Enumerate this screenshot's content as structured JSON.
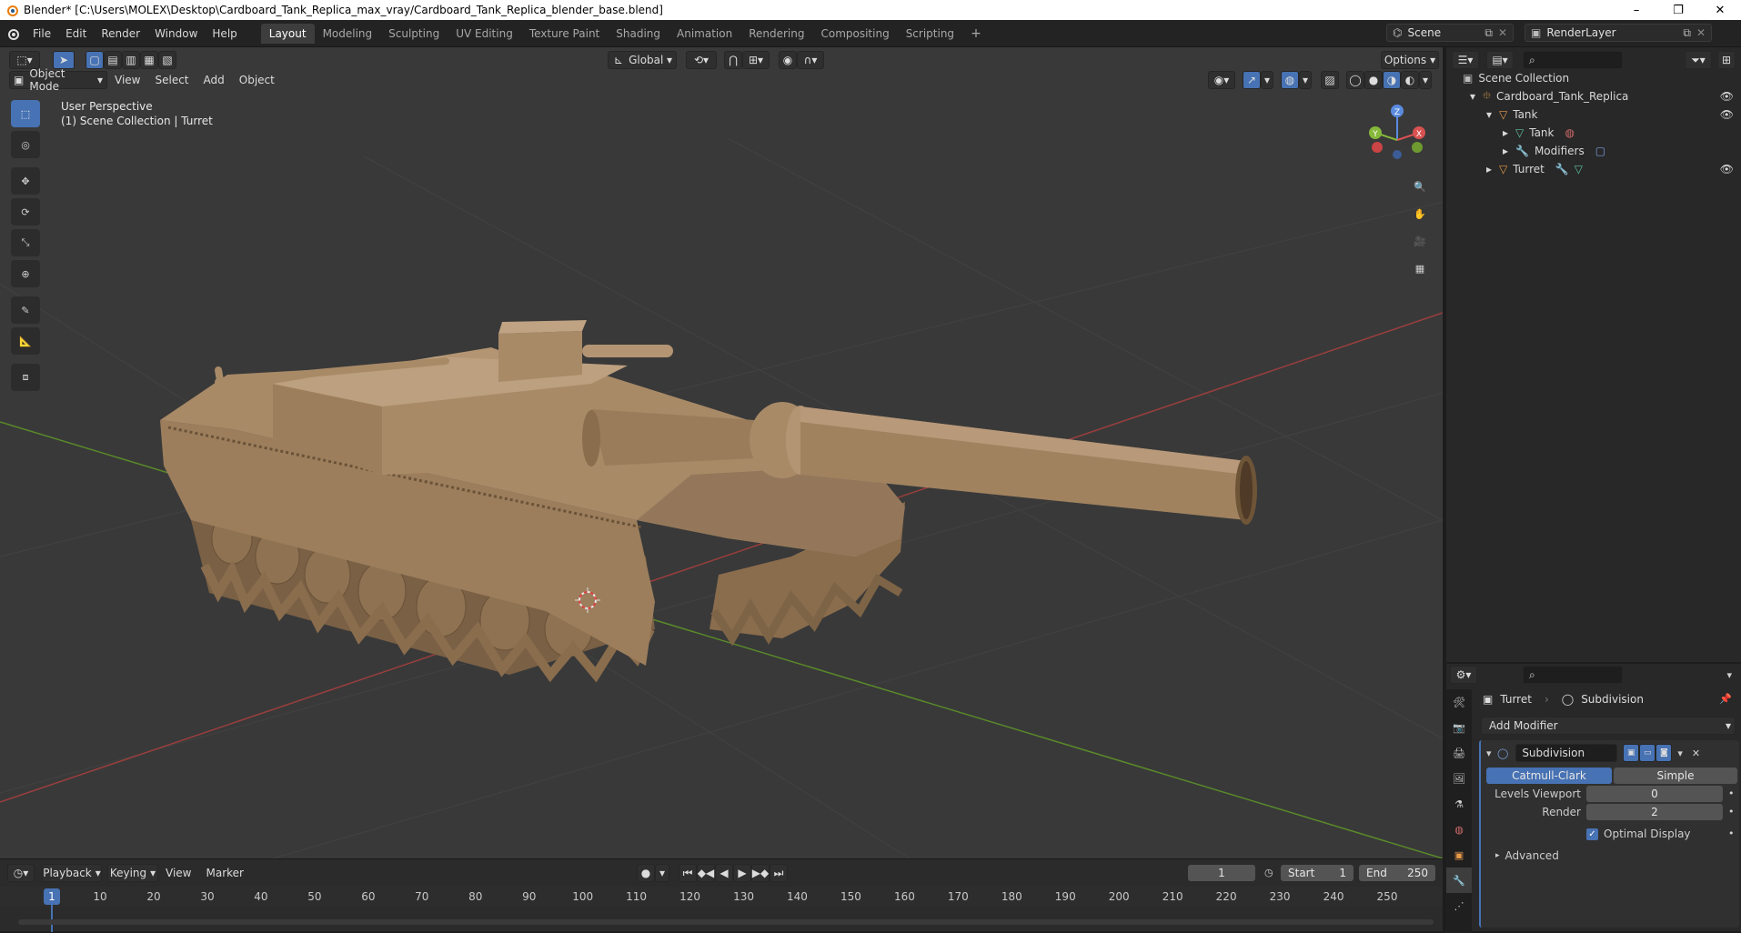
{
  "window": {
    "title": "Blender* [C:\\Users\\MOLEX\\Desktop\\Cardboard_Tank_Replica_max_vray/Cardboard_Tank_Replica_blender_base.blend]",
    "minimize": "–",
    "maximize": "❐",
    "close": "✕"
  },
  "menu": [
    "File",
    "Edit",
    "Render",
    "Window",
    "Help"
  ],
  "workspaces": [
    "Layout",
    "Modeling",
    "Sculpting",
    "UV Editing",
    "Texture Paint",
    "Shading",
    "Animation",
    "Rendering",
    "Compositing",
    "Scripting"
  ],
  "active_workspace": "Layout",
  "add_workspace": "+",
  "scene": {
    "name": "Scene",
    "render_layer": "RenderLayer"
  },
  "viewport": {
    "mode": "Object Mode",
    "menus": [
      "View",
      "Select",
      "Add",
      "Object"
    ],
    "orientation": "Global",
    "options": "Options",
    "perspective": "User Perspective",
    "context": "(1) Scene Collection | Turret",
    "gizmo": {
      "x": "X",
      "y": "Y",
      "z": "Z"
    }
  },
  "tools": [
    "select-box",
    "cursor",
    "move",
    "rotate",
    "scale",
    "transform",
    "annotate",
    "measure",
    "add-cube"
  ],
  "outliner": {
    "root": "Scene Collection",
    "items": [
      {
        "label": "Cardboard_Tank_Replica",
        "depth": 0,
        "expanded": true
      },
      {
        "label": "Tank",
        "depth": 1,
        "expanded": true
      },
      {
        "label": "Tank",
        "depth": 2,
        "expanded": false
      },
      {
        "label": "Modifiers",
        "depth": 2,
        "expanded": false
      },
      {
        "label": "Turret",
        "depth": 1,
        "expanded": false
      }
    ]
  },
  "properties": {
    "object": "Turret",
    "modifier_context": "Subdivision",
    "add_modifier": "Add Modifier",
    "modifier": {
      "name": "Subdivision",
      "types": [
        "Catmull-Clark",
        "Simple"
      ],
      "active_type": "Catmull-Clark",
      "levels_viewport_label": "Levels Viewport",
      "levels_viewport": "0",
      "render_label": "Render",
      "render": "2",
      "optimal_display_label": "Optimal Display",
      "optimal_display": true,
      "advanced": "Advanced"
    }
  },
  "timeline": {
    "menus": [
      "Playback",
      "Keying",
      "View",
      "Marker"
    ],
    "current_frame": "1",
    "start_label": "Start",
    "start": "1",
    "end_label": "End",
    "end": "250",
    "ticks": [
      "1",
      "10",
      "20",
      "30",
      "40",
      "50",
      "60",
      "70",
      "80",
      "90",
      "100",
      "110",
      "120",
      "130",
      "140",
      "150",
      "160",
      "170",
      "180",
      "190",
      "200",
      "210",
      "220",
      "230",
      "240",
      "250"
    ]
  },
  "colors": {
    "accent": "#4772b3",
    "viewport_bg": "#393939",
    "panel_bg": "#282828",
    "axis_red": "#b34a4a",
    "axis_green": "#6c9f35",
    "cardboard": "#9a7b5a"
  }
}
